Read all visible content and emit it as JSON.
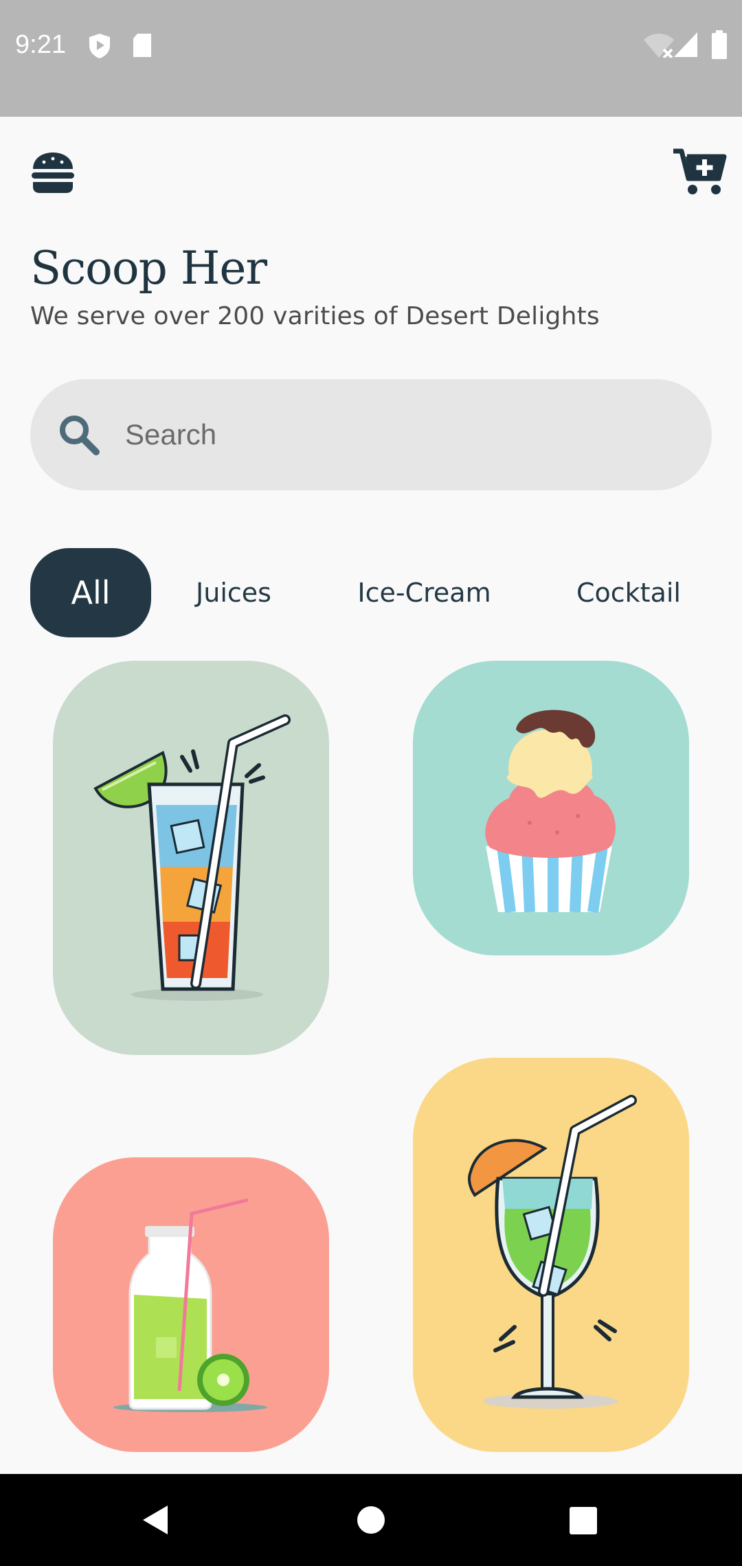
{
  "status_bar": {
    "time": "9:21",
    "icons": [
      "shield-play-icon",
      "sd-card-icon",
      "wifi-off-icon",
      "signal-icon",
      "battery-icon"
    ]
  },
  "header": {
    "menu_icon": "burger-menu-icon",
    "cart_icon": "cart-add-icon"
  },
  "hero": {
    "title": "Scoop Her",
    "subtitle": "We serve over 200 varities of Desert Delights"
  },
  "search": {
    "placeholder": "Search",
    "value": ""
  },
  "categories": {
    "tabs": [
      "All",
      "Juices",
      "Ice-Cream",
      "Cocktail"
    ],
    "selected": "All"
  },
  "products": [
    {
      "illustration": "orange-soda-glass",
      "bg": "#c9dbcc"
    },
    {
      "illustration": "ice-cream-cup",
      "bg": "#a4dcd1"
    },
    {
      "illustration": "lime-juice-bottle",
      "bg": "#fb9f92"
    },
    {
      "illustration": "green-cocktail",
      "bg": "#fad888"
    }
  ],
  "colors": {
    "primary": "#233844",
    "background": "#f9f9f9",
    "search_bg": "#e6e6e6"
  },
  "nav_bar": {
    "icons": [
      "back-icon",
      "home-icon",
      "recents-icon"
    ]
  }
}
